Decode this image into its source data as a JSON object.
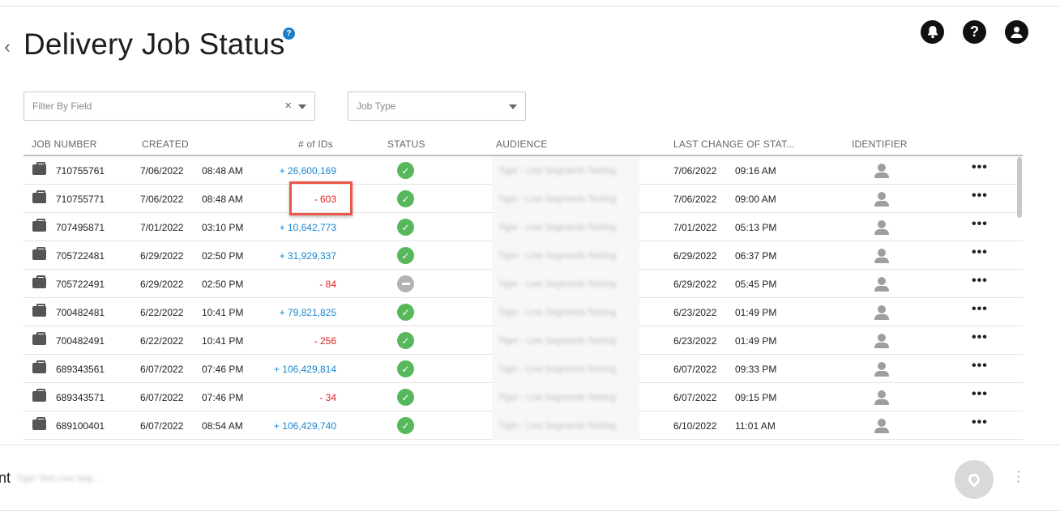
{
  "page": {
    "title": "Delivery Job Status",
    "help_badge": "?"
  },
  "filters": {
    "field_placeholder": "Filter By Field",
    "field_clear": "×",
    "jobtype_placeholder": "Job Type"
  },
  "table": {
    "headers": {
      "job_number": "JOB NUMBER",
      "created": "CREATED",
      "ids": "# of IDs",
      "status": "STATUS",
      "audience": "AUDIENCE",
      "last_change": "LAST CHANGE OF STAT...",
      "identifier": "IDENTIFIER"
    },
    "rows": [
      {
        "job": "710755761",
        "cdate": "7/06/2022",
        "ctime": "08:48 AM",
        "ids": "+ 26,600,169",
        "sign": "pos",
        "status": "ok",
        "audience": "Tiger - Live Segments Testing",
        "ldate": "7/06/2022",
        "ltime": "09:16 AM"
      },
      {
        "job": "710755771",
        "cdate": "7/06/2022",
        "ctime": "08:48 AM",
        "ids": "- 603",
        "sign": "neg",
        "status": "ok",
        "audience": "Tiger - Live Segments Testing",
        "ldate": "7/06/2022",
        "ltime": "09:00 AM"
      },
      {
        "job": "707495871",
        "cdate": "7/01/2022",
        "ctime": "03:10 PM",
        "ids": "+ 10,642,773",
        "sign": "pos",
        "status": "ok",
        "audience": "Tiger - Live Segments Testing",
        "ldate": "7/01/2022",
        "ltime": "05:13 PM"
      },
      {
        "job": "705722481",
        "cdate": "6/29/2022",
        "ctime": "02:50 PM",
        "ids": "+ 31,929,337",
        "sign": "pos",
        "status": "ok",
        "audience": "Tiger - Live Segments Testing",
        "ldate": "6/29/2022",
        "ltime": "06:37 PM"
      },
      {
        "job": "705722491",
        "cdate": "6/29/2022",
        "ctime": "02:50 PM",
        "ids": "- 84",
        "sign": "neg",
        "status": "neutral",
        "audience": "Tiger - Live Segments Testing",
        "ldate": "6/29/2022",
        "ltime": "05:45 PM"
      },
      {
        "job": "700482481",
        "cdate": "6/22/2022",
        "ctime": "10:41 PM",
        "ids": "+ 79,821,825",
        "sign": "pos",
        "status": "ok",
        "audience": "Tiger - Live Segments Testing",
        "ldate": "6/23/2022",
        "ltime": "01:49 PM"
      },
      {
        "job": "700482491",
        "cdate": "6/22/2022",
        "ctime": "10:41 PM",
        "ids": "- 256",
        "sign": "neg",
        "status": "ok",
        "audience": "Tiger - Live Segments Testing",
        "ldate": "6/23/2022",
        "ltime": "01:49 PM"
      },
      {
        "job": "689343561",
        "cdate": "6/07/2022",
        "ctime": "07:46 PM",
        "ids": "+ 106,429,814",
        "sign": "pos",
        "status": "ok",
        "audience": "Tiger - Live Segments Testing",
        "ldate": "6/07/2022",
        "ltime": "09:33 PM"
      },
      {
        "job": "689343571",
        "cdate": "6/07/2022",
        "ctime": "07:46 PM",
        "ids": "- 34",
        "sign": "neg",
        "status": "ok",
        "audience": "Tiger - Live Segments Testing",
        "ldate": "6/07/2022",
        "ltime": "09:15 PM"
      },
      {
        "job": "689100401",
        "cdate": "6/07/2022",
        "ctime": "08:54 AM",
        "ids": "+ 106,429,740",
        "sign": "pos",
        "status": "ok",
        "audience": "Tiger - Live Segments Testing",
        "ldate": "6/10/2022",
        "ltime": "11:01 AM"
      }
    ],
    "row_menu": "•••"
  },
  "bottom": {
    "label": "nt",
    "blurred_text": "Tiger Test Live Seg..."
  },
  "icons": {
    "back": "chevron-left-icon",
    "bell": "bell-icon",
    "help": "help-icon",
    "user": "user-icon",
    "briefcase": "briefcase-icon",
    "check": "check-circle-icon",
    "identifier": "person-icon",
    "pin": "map-pin-icon",
    "kebab": "kebab-icon"
  },
  "colors": {
    "positive": "#1a86d0",
    "negative": "#e02020",
    "status_ok": "#56b85a",
    "status_neutral": "#b3b3b3",
    "highlight": "#e8574a",
    "help_badge": "#1e7fc8"
  }
}
